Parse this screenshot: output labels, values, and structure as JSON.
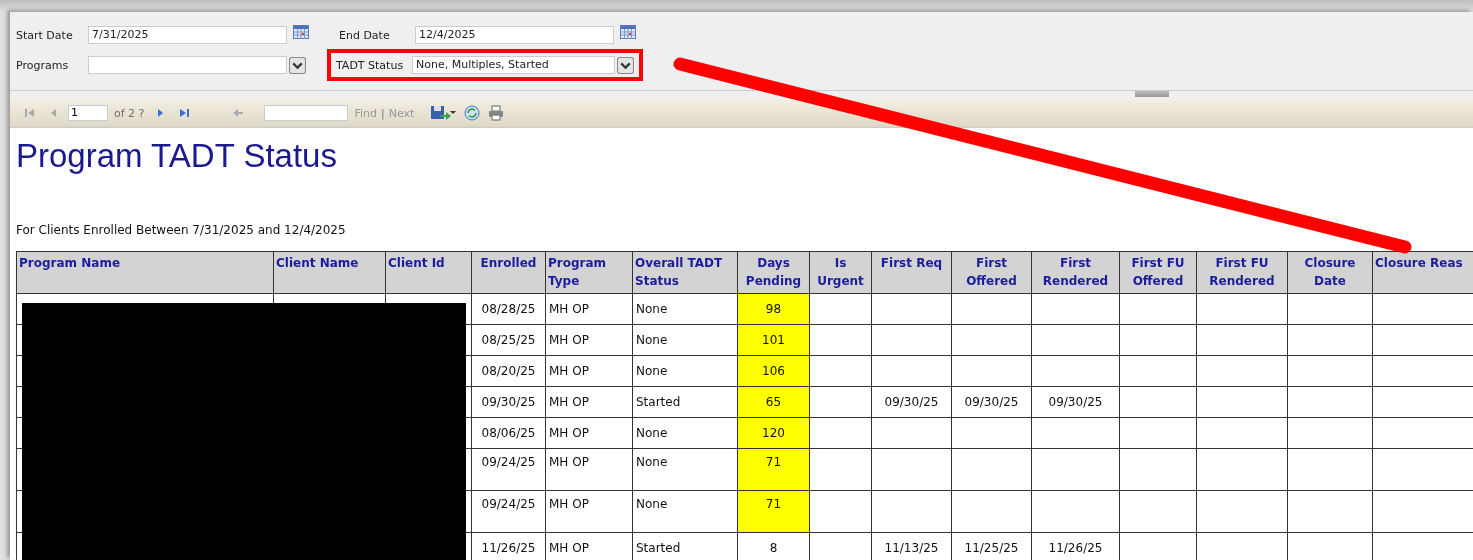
{
  "parameters": {
    "start_date": {
      "label": "Start Date",
      "value": "7/31/2025"
    },
    "end_date": {
      "label": "End Date",
      "value": "12/4/2025"
    },
    "programs": {
      "label": "Programs"
    },
    "tadt_status": {
      "label": "TADT Status",
      "value": "None, Multiples, Started"
    }
  },
  "toolbar": {
    "page": "1",
    "page_count": "of 2 ?",
    "find": "Find",
    "separator": "|",
    "next": "Next"
  },
  "report": {
    "title": "Program TADT Status",
    "subtitle": "For Clients Enrolled Between 7/31/2025 and 12/4/2025"
  },
  "table": {
    "columns": [
      "Program Name",
      "Client Name",
      "Client Id",
      "Enrolled",
      "Program Type",
      "Overall TADT Status",
      "Days Pending",
      "Is Urgent",
      "First Req",
      "First Offered",
      "First Rendered",
      "First FU Offered",
      "First FU Rendered",
      "Closure Date",
      "Closure Reas"
    ],
    "rows": [
      {
        "enrolled": "08/28/25",
        "program_type": "MH OP",
        "status": "None",
        "days_pending": "98",
        "highlight": true
      },
      {
        "enrolled": "08/25/25",
        "program_type": "MH OP",
        "status": "None",
        "days_pending": "101",
        "highlight": true
      },
      {
        "enrolled": "08/20/25",
        "program_type": "MH OP",
        "status": "None",
        "days_pending": "106",
        "highlight": true
      },
      {
        "enrolled": "09/30/25",
        "program_type": "MH OP",
        "status": "Started",
        "days_pending": "65",
        "highlight": true,
        "first_req": "09/30/25",
        "first_offered": "09/30/25",
        "first_rendered": "09/30/25"
      },
      {
        "enrolled": "08/06/25",
        "program_type": "MH OP",
        "status": "None",
        "days_pending": "120",
        "highlight": true
      },
      {
        "enrolled": "09/24/25",
        "program_type": "MH OP",
        "status": "None",
        "days_pending": "71",
        "highlight": true
      },
      {
        "enrolled": "09/24/25",
        "program_type": "MH OP",
        "status": "None",
        "days_pending": "71",
        "highlight": true
      },
      {
        "enrolled": "11/26/25",
        "program_type": "MH OP",
        "status": "Started",
        "days_pending": "8",
        "highlight": false,
        "first_req": "11/13/25",
        "first_offered": "11/25/25",
        "first_rendered": "11/26/25"
      }
    ]
  }
}
